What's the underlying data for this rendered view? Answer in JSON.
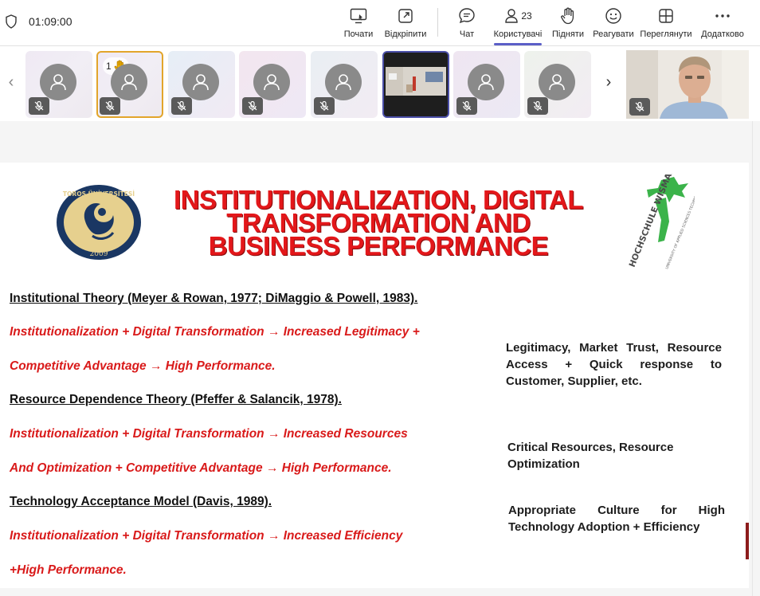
{
  "toolbar": {
    "timer": "01:09:00",
    "buttons": [
      {
        "label": "Почати",
        "icon": "share-screen-icon"
      },
      {
        "label": "Відкріпити",
        "icon": "pop-out-icon"
      },
      {
        "label": "Чат",
        "icon": "chat-icon"
      },
      {
        "label": "Користувачі",
        "icon": "people-icon",
        "count": "23"
      },
      {
        "label": "Підняти",
        "icon": "raise-hand-icon"
      },
      {
        "label": "Реагувати",
        "icon": "react-icon"
      },
      {
        "label": "Переглянути",
        "icon": "view-icon"
      },
      {
        "label": "Додатково",
        "icon": "more-icon"
      }
    ]
  },
  "participants": {
    "hand_count": "1"
  },
  "slide": {
    "title": "INSTITUTIONALIZATION, DIGITAL TRANSFORMATION AND BUSINESS PERFORMANCE",
    "logo_left": {
      "text_top": "TOROS ÜNİVERSİTESİ",
      "year": "2009"
    },
    "logo_right": {
      "text": "HOCHSCHULE WISMAR",
      "subtext": "UNIVERSITY OF APPLIED SCIENCES TECHNOLOGY, BUSINESS AND DESIGN"
    },
    "lines": [
      {
        "kind": "theory",
        "text": "Institutional Theory (Meyer & Rowan, 1977; DiMaggio & Powell, 1983)."
      },
      {
        "kind": "eq",
        "text": "Institutionalization + Digital Transformation → Increased Legitimacy +"
      },
      {
        "kind": "eq",
        "text": "Competitive Advantage → High Performance."
      },
      {
        "kind": "theory",
        "text": "Resource Dependence Theory (Pfeffer & Salancik, 1978)."
      },
      {
        "kind": "eq",
        "text": "Institutionalization + Digital Transformation → Increased Resources"
      },
      {
        "kind": "eq",
        "text": "And Optimization + Competitive Advantage → High Performance."
      },
      {
        "kind": "theory",
        "text": "Technology Acceptance Model (Davis, 1989)."
      },
      {
        "kind": "eq",
        "text": "Institutionalization + Digital Transformation → Increased Efficiency"
      },
      {
        "kind": "eq",
        "text": "+High Performance."
      }
    ],
    "side_notes": [
      "Legitimacy, Market Trust, Resource Access + Quick response to Customer, Supplier, etc.",
      "Critical Resources, Resource Optimization",
      "Appropriate Culture for High Technology Adoption + Efficiency"
    ]
  },
  "colors": {
    "accent": "#5b5fc7",
    "title_red": "#e3171a",
    "equation_red": "#d91a1a",
    "raise_hand_border": "#e2a52b"
  }
}
